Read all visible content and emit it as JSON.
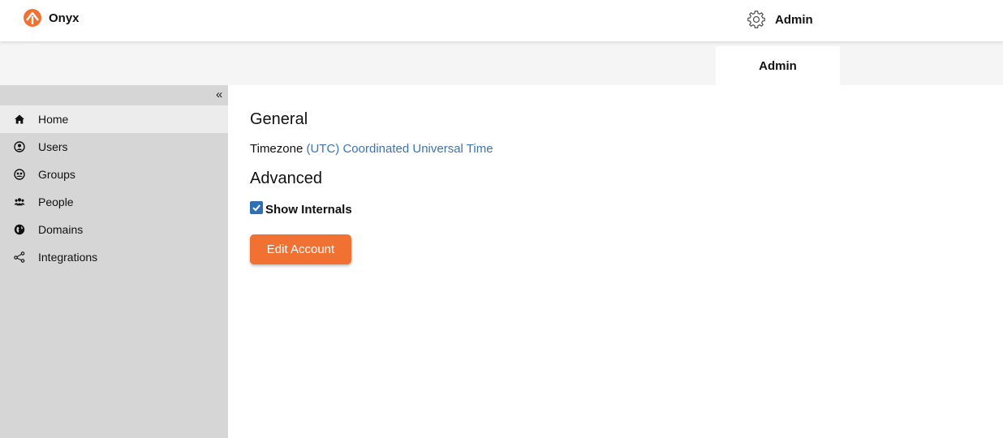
{
  "header": {
    "brand_name": "Onyx",
    "logo_icon": "onyx-logo",
    "settings_icon": "gear-icon",
    "user_label": "Admin"
  },
  "tabs": [
    {
      "label": "Admin",
      "active": true
    }
  ],
  "sidebar": {
    "collapse_label": "«",
    "items": [
      {
        "label": "Home",
        "icon": "home-icon",
        "active": true
      },
      {
        "label": "Users",
        "icon": "user-circle-icon"
      },
      {
        "label": "Groups",
        "icon": "group-circle-icon"
      },
      {
        "label": "People",
        "icon": "people-icon"
      },
      {
        "label": "Domains",
        "icon": "globe-icon"
      },
      {
        "label": "Integrations",
        "icon": "share-nodes-icon"
      }
    ]
  },
  "main": {
    "general_heading": "General",
    "timezone_label": "Timezone",
    "timezone_value": "(UTC) Coordinated Universal Time",
    "advanced_heading": "Advanced",
    "show_internals_label": "Show Internals",
    "show_internals_checked": true,
    "edit_button": "Edit Account"
  },
  "colors": {
    "accent": "#f07132",
    "link": "#3d74b0",
    "checkbox": "#2f6fb5",
    "sidebar_bg": "#d6d6d6"
  }
}
